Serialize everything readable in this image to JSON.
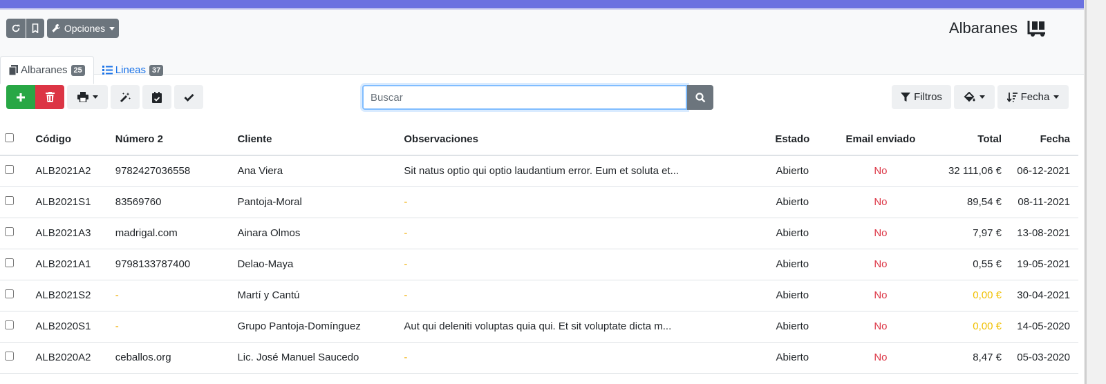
{
  "header": {
    "title": "Albaranes",
    "options_label": "Opciones",
    "tabs": [
      {
        "label": "Albaranes",
        "count": "25"
      },
      {
        "label": "Lineas",
        "count": "37"
      }
    ]
  },
  "toolbar": {
    "search_placeholder": "Buscar",
    "filters_label": "Filtros",
    "sort_label": "Fecha"
  },
  "table": {
    "columns": [
      "Código",
      "Número 2",
      "Cliente",
      "Observaciones",
      "Estado",
      "Email enviado",
      "Total",
      "Fecha"
    ],
    "rows": [
      {
        "codigo": "ALB2021A2",
        "numero2": "9782427036558",
        "cliente": "Ana Viera",
        "observaciones": "Sit natus optio qui optio laudantium error. Eum et soluta et...",
        "estado": "Abierto",
        "email": "No",
        "total": "32 111,06 €",
        "fecha": "06-12-2021"
      },
      {
        "codigo": "ALB2021S1",
        "numero2": "83569760",
        "cliente": "Pantoja-Moral",
        "observaciones": "-",
        "estado": "Abierto",
        "email": "No",
        "total": "89,54 €",
        "fecha": "08-11-2021"
      },
      {
        "codigo": "ALB2021A3",
        "numero2": "madrigal.com",
        "cliente": "Ainara Olmos",
        "observaciones": "-",
        "estado": "Abierto",
        "email": "No",
        "total": "7,97 €",
        "fecha": "13-08-2021"
      },
      {
        "codigo": "ALB2021A1",
        "numero2": "9798133787400",
        "cliente": "Delao-Maya",
        "observaciones": "-",
        "estado": "Abierto",
        "email": "No",
        "total": "0,55 €",
        "fecha": "19-05-2021"
      },
      {
        "codigo": "ALB2021S2",
        "numero2": "-",
        "cliente": "Martí y Cantú",
        "observaciones": "-",
        "estado": "Abierto",
        "email": "No",
        "total": "0,00 €",
        "fecha": "30-04-2021"
      },
      {
        "codigo": "ALB2020S1",
        "numero2": "-",
        "cliente": "Grupo Pantoja-Domínguez",
        "observaciones": "Aut qui deleniti voluptas quia qui. Et sit voluptate dicta m...",
        "estado": "Abierto",
        "email": "No",
        "total": "0,00 €",
        "fecha": "14-05-2020"
      },
      {
        "codigo": "ALB2020A2",
        "numero2": "ceballos.org",
        "cliente": "Lic. José Manuel Saucedo",
        "observaciones": "-",
        "estado": "Abierto",
        "email": "No",
        "total": "8,47 €",
        "fecha": "05-03-2020"
      }
    ]
  },
  "colors": {
    "accent_bar": "#6b72e0",
    "dash": "#f0ad00",
    "no": "#dc3545",
    "zero_total": "#f0c000"
  },
  "icons": [
    "refresh-icon",
    "bookmark-icon",
    "wrench-icon",
    "truck-loading-icon",
    "documents-icon",
    "list-icon",
    "plus-icon",
    "trash-icon",
    "print-icon",
    "magic-icon",
    "calendar-check-icon",
    "check-icon",
    "search-icon",
    "filter-icon",
    "paint-bucket-icon",
    "sort-icon"
  ]
}
